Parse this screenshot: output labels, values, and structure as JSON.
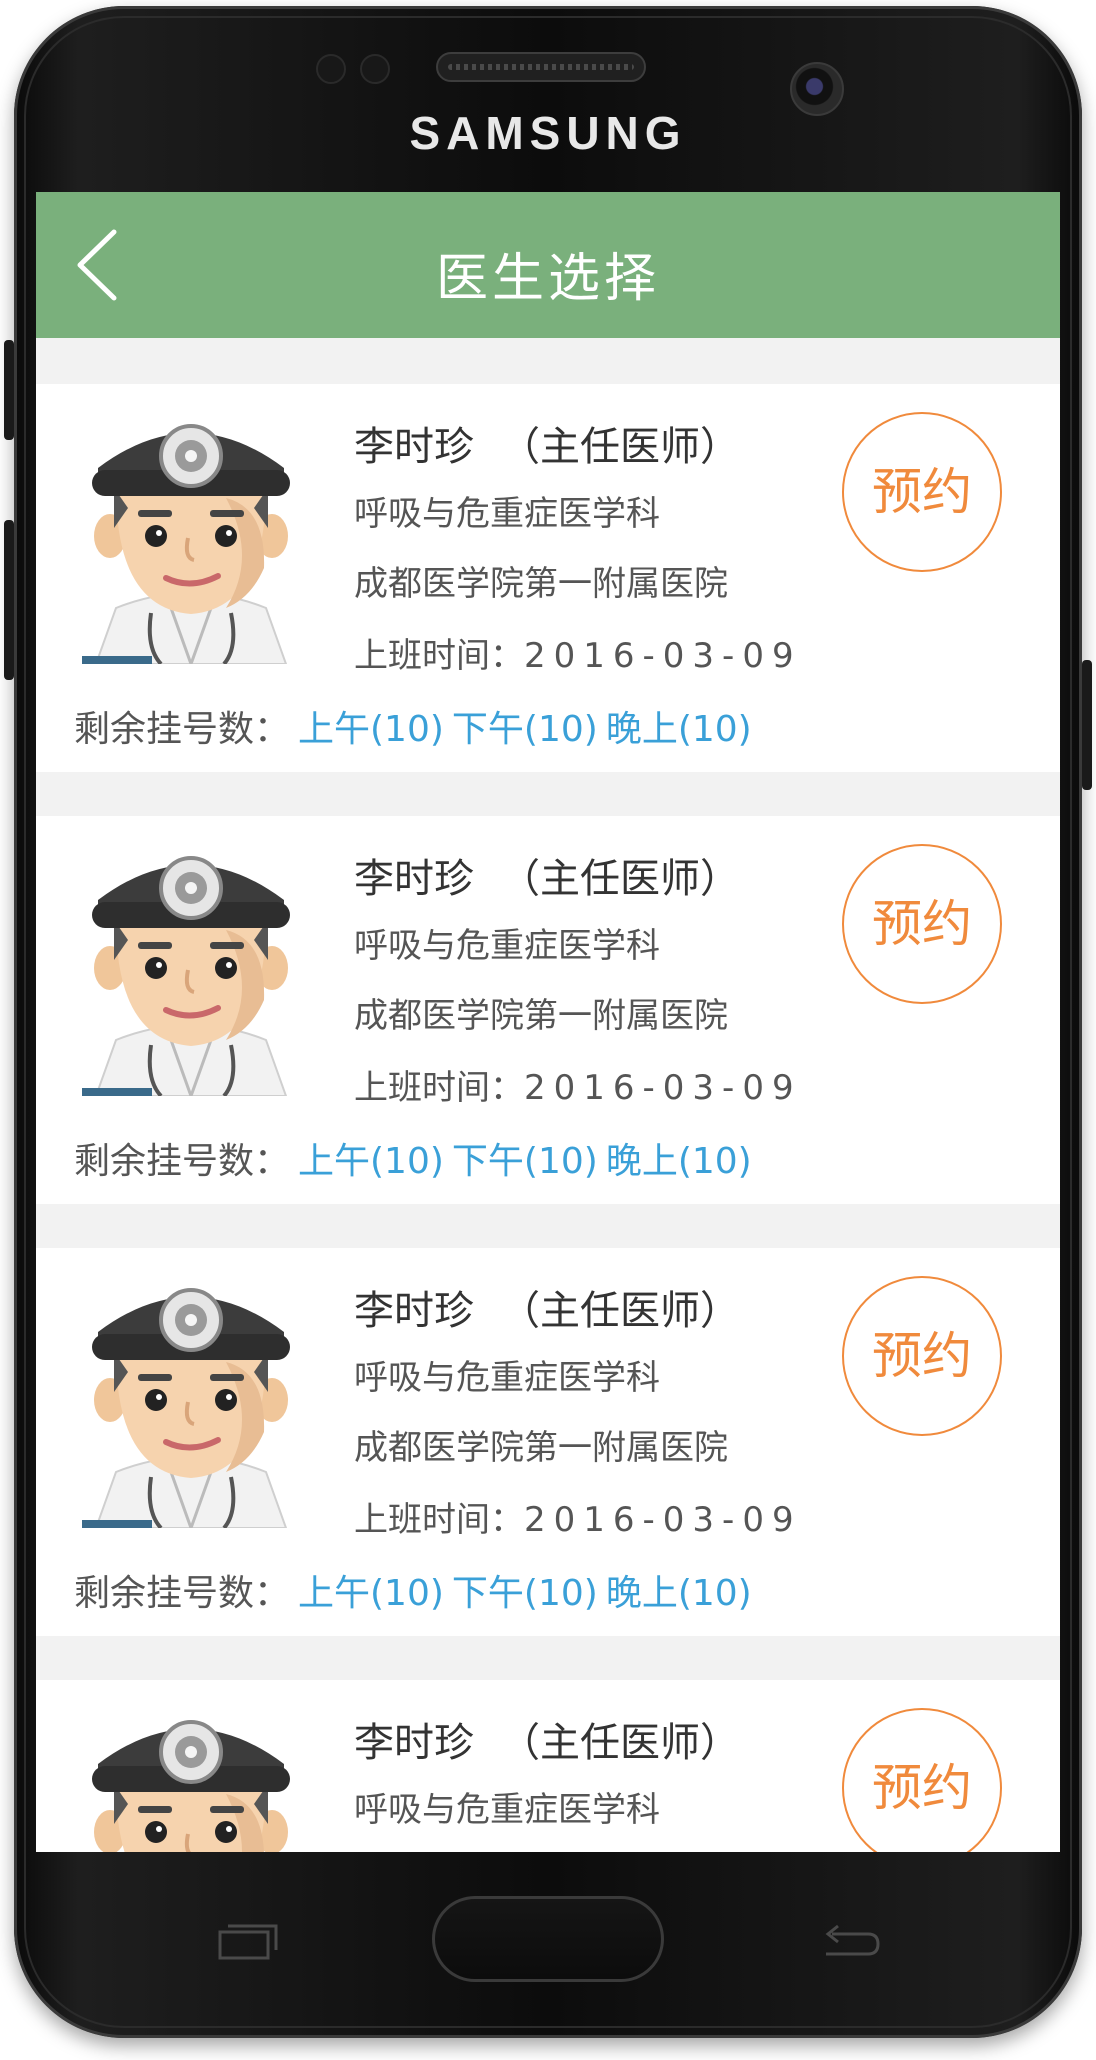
{
  "device": {
    "brand": "SAMSUNG"
  },
  "header": {
    "title": "医生选择"
  },
  "doctors": [
    {
      "name": "李时珍",
      "title": "（主任医师）",
      "department": "呼吸与危重症医学科",
      "hospital": "成都医学院第一附属医院",
      "work_time_label": "上班时间：",
      "work_time_date": "2016-03-09",
      "remain_label": "剩余挂号数：",
      "slots": [
        "上午(10)",
        "下午(10)",
        "晚上(10)"
      ],
      "book_label": "预约"
    },
    {
      "name": "李时珍",
      "title": "（主任医师）",
      "department": "呼吸与危重症医学科",
      "hospital": "成都医学院第一附属医院",
      "work_time_label": "上班时间：",
      "work_time_date": "2016-03-09",
      "remain_label": "剩余挂号数：",
      "slots": [
        "上午(10)",
        "下午(10)",
        "晚上(10)"
      ],
      "book_label": "预约"
    },
    {
      "name": "李时珍",
      "title": "（主任医师）",
      "department": "呼吸与危重症医学科",
      "hospital": "成都医学院第一附属医院",
      "work_time_label": "上班时间：",
      "work_time_date": "2016-03-09",
      "remain_label": "剩余挂号数：",
      "slots": [
        "上午(10)",
        "下午(10)",
        "晚上(10)"
      ],
      "book_label": "预约"
    },
    {
      "name": "李时珍",
      "title": "（主任医师）",
      "department": "呼吸与危重症医学科",
      "book_label": "预约"
    }
  ],
  "icons": {
    "back": "chevron-left-icon",
    "avatar": "doctor-avatar-icon",
    "recent_apps": "recent-apps-icon",
    "back_key": "back-arrow-icon"
  },
  "colors": {
    "header_bg": "#7ab07c",
    "book_accent": "#f08a3c",
    "slot_link": "#3aa0d8",
    "list_bg": "#f2f2f2"
  }
}
